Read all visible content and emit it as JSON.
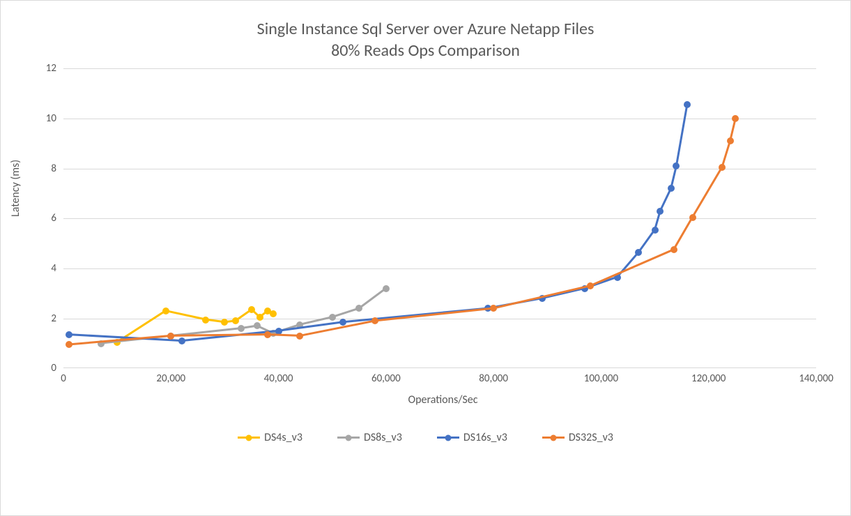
{
  "chart_data": {
    "type": "line",
    "title": "Single Instance Sql Server over Azure Netapp Files\n80% Reads Ops Comparison",
    "xlabel": "Operations/Sec",
    "ylabel": "Latency (ms)",
    "xlim": [
      0,
      140000
    ],
    "ylim": [
      0,
      12
    ],
    "x_ticks": [
      0,
      20000,
      40000,
      60000,
      80000,
      100000,
      120000,
      140000
    ],
    "x_tick_labels": [
      "0",
      "20,000",
      "40,000",
      "60,000",
      "80,000",
      "100,000",
      "120,000",
      "140,000"
    ],
    "y_ticks": [
      0,
      2,
      4,
      6,
      8,
      10,
      12
    ],
    "series": [
      {
        "name": "DS4s_v3",
        "color": "#FFC000",
        "points": [
          {
            "x": 10000,
            "y": 1.05
          },
          {
            "x": 19000,
            "y": 2.3
          },
          {
            "x": 26500,
            "y": 1.95
          },
          {
            "x": 30000,
            "y": 1.85
          },
          {
            "x": 32000,
            "y": 1.9
          },
          {
            "x": 35000,
            "y": 2.35
          },
          {
            "x": 36500,
            "y": 2.05
          },
          {
            "x": 38000,
            "y": 2.3
          },
          {
            "x": 39000,
            "y": 2.2
          }
        ]
      },
      {
        "name": "DS8s_v3",
        "color": "#A6A6A6",
        "points": [
          {
            "x": 7000,
            "y": 1.0
          },
          {
            "x": 20000,
            "y": 1.3
          },
          {
            "x": 33000,
            "y": 1.6
          },
          {
            "x": 36000,
            "y": 1.7
          },
          {
            "x": 39000,
            "y": 1.4
          },
          {
            "x": 44000,
            "y": 1.75
          },
          {
            "x": 50000,
            "y": 2.05
          },
          {
            "x": 55000,
            "y": 2.4
          },
          {
            "x": 60000,
            "y": 3.2
          }
        ]
      },
      {
        "name": "DS16s_v3",
        "color": "#4472C4",
        "points": [
          {
            "x": 1000,
            "y": 1.35
          },
          {
            "x": 22000,
            "y": 1.1
          },
          {
            "x": 40000,
            "y": 1.5
          },
          {
            "x": 52000,
            "y": 1.85
          },
          {
            "x": 79000,
            "y": 2.4
          },
          {
            "x": 89000,
            "y": 2.8
          },
          {
            "x": 97000,
            "y": 3.2
          },
          {
            "x": 103000,
            "y": 3.65
          },
          {
            "x": 107000,
            "y": 4.65
          },
          {
            "x": 110000,
            "y": 5.55
          },
          {
            "x": 111000,
            "y": 6.3
          },
          {
            "x": 113000,
            "y": 7.2
          },
          {
            "x": 114000,
            "y": 8.1
          },
          {
            "x": 116000,
            "y": 10.55
          }
        ]
      },
      {
        "name": "DS32S_v3",
        "color": "#ED7D31",
        "points": [
          {
            "x": 1000,
            "y": 0.95
          },
          {
            "x": 20000,
            "y": 1.3
          },
          {
            "x": 38000,
            "y": 1.35
          },
          {
            "x": 44000,
            "y": 1.3
          },
          {
            "x": 58000,
            "y": 1.9
          },
          {
            "x": 80000,
            "y": 2.4
          },
          {
            "x": 98000,
            "y": 3.3
          },
          {
            "x": 113500,
            "y": 4.75
          },
          {
            "x": 117000,
            "y": 6.05
          },
          {
            "x": 122500,
            "y": 8.05
          },
          {
            "x": 124000,
            "y": 9.1
          },
          {
            "x": 125000,
            "y": 10.0
          }
        ]
      }
    ]
  }
}
